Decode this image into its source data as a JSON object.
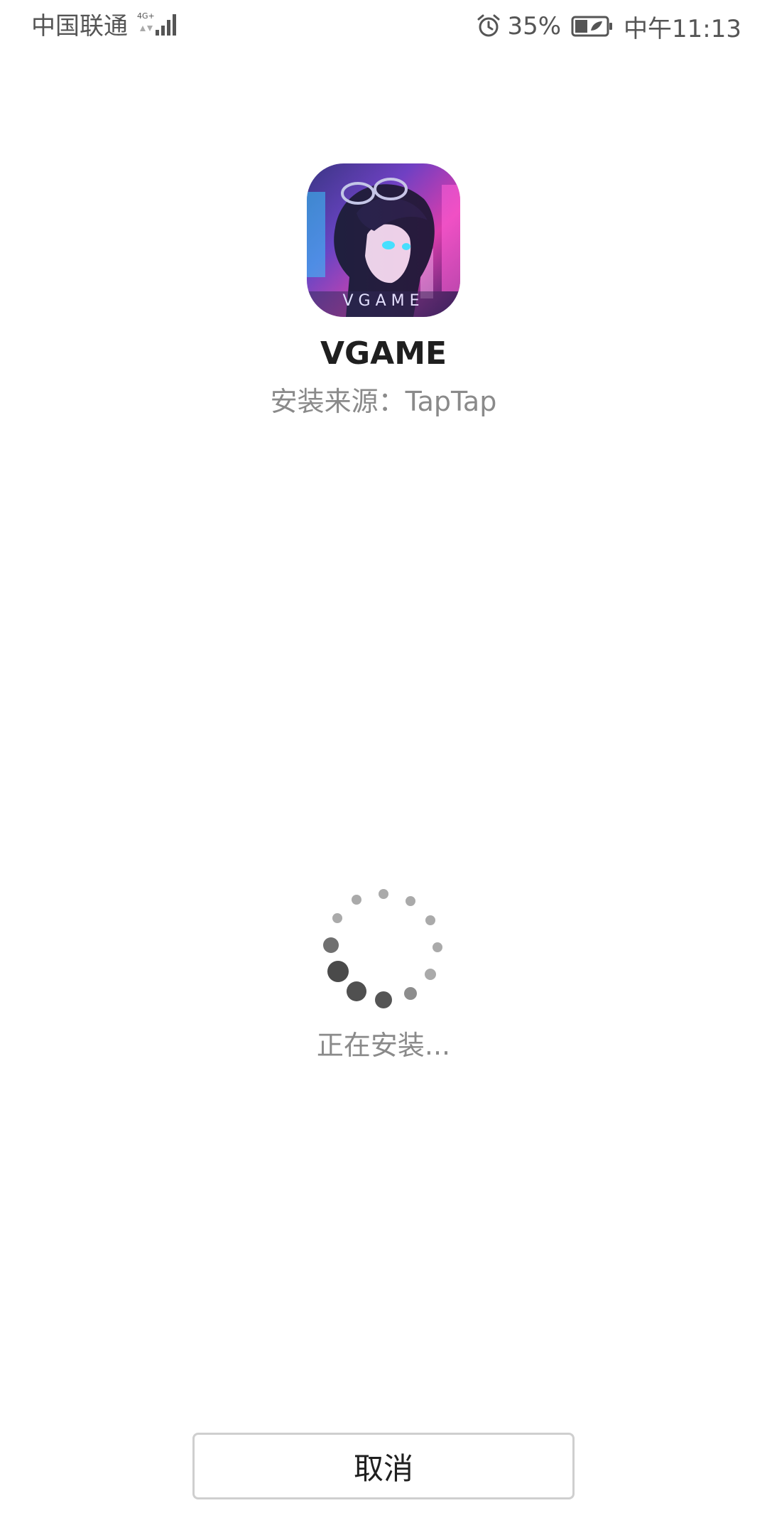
{
  "status_bar": {
    "carrier": "中国联通",
    "network": "4G+",
    "battery_percent": "35%",
    "time": "中午11:13",
    "icons": [
      "signal-icon",
      "alarm-icon",
      "battery-icon"
    ]
  },
  "app": {
    "name": "VGAME",
    "icon_text": "VGAME",
    "source_label": "安装来源：",
    "source_value": "TapTap"
  },
  "install": {
    "status_text": "正在安装..."
  },
  "actions": {
    "cancel_label": "取消"
  },
  "colors": {
    "background": "#ffffff",
    "primary_text": "#1f1f1f",
    "secondary_text": "#8a8a8a",
    "button_border": "#cfcfcf"
  }
}
